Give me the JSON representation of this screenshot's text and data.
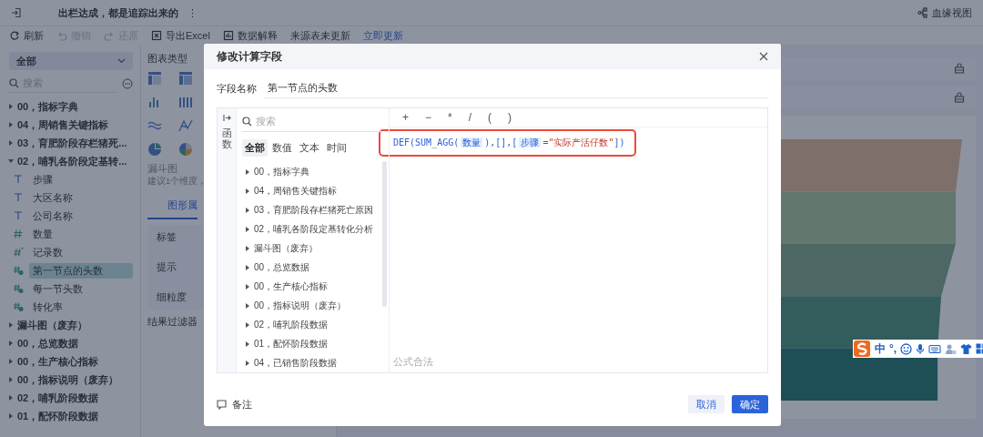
{
  "header": {
    "title": "出栏达成，都是追踪出来的",
    "more": "⋮",
    "lineage": "血缘视图"
  },
  "toolbar": [
    {
      "label": "刷新",
      "disabled": false
    },
    {
      "label": "撤销",
      "disabled": true
    },
    {
      "label": "还原",
      "disabled": true
    },
    {
      "label": "导出Excel",
      "disabled": false
    },
    {
      "label": "数据解释",
      "disabled": false
    }
  ],
  "update_notice": {
    "text": "来源表未更新",
    "link": "立即更新"
  },
  "sidebar": {
    "dropdown": "全部",
    "search_placeholder": "搜索",
    "tree": [
      {
        "label": "00，指标字典",
        "expanded": false,
        "selected": false
      },
      {
        "label": "04，周销售关键指标",
        "expanded": false,
        "selected": false
      },
      {
        "label": "03，育肥阶段存栏猪死...",
        "expanded": false,
        "selected": false
      },
      {
        "label": "02，哺乳各阶段定基转...",
        "expanded": true,
        "selected": false,
        "children": [
          {
            "label": "步骤",
            "kind": "text",
            "selected": false
          },
          {
            "label": "大区名称",
            "kind": "text",
            "selected": false
          },
          {
            "label": "公司名称",
            "kind": "text",
            "selected": false
          },
          {
            "label": "数量",
            "kind": "number",
            "selected": false
          },
          {
            "label": "记录数",
            "kind": "record",
            "selected": false
          },
          {
            "label": "第一节点的头数",
            "kind": "calc",
            "selected": true
          },
          {
            "label": "每一节头数",
            "kind": "calc",
            "selected": false
          },
          {
            "label": "转化率",
            "kind": "calc",
            "selected": false
          }
        ]
      },
      {
        "label": "漏斗图（废弃）",
        "expanded": false,
        "selected": false
      },
      {
        "label": "00，总览数据",
        "expanded": false,
        "selected": false
      },
      {
        "label": "00，生产核心指标",
        "expanded": false,
        "selected": false
      },
      {
        "label": "00，指标说明（废弃）",
        "expanded": false,
        "selected": false
      },
      {
        "label": "02，哺乳阶段数据",
        "expanded": false,
        "selected": false
      },
      {
        "label": "01，配怀阶段数据",
        "expanded": false,
        "selected": false
      }
    ]
  },
  "chart_panel": {
    "title": "图表类型",
    "chart_name": "漏斗图",
    "hint": "建议1个维度，",
    "tab": "图形属",
    "properties": [
      "标签",
      "提示",
      "细粒度"
    ],
    "filter_title": "结果过滤器"
  },
  "ime": {
    "mode": "中",
    "punct": "°,"
  },
  "dialog": {
    "title": "修改计算字段",
    "field_label": "字段名称",
    "field_value": "第一节点的头数",
    "side_tab": "函数",
    "search_placeholder": "搜索",
    "categories": [
      {
        "label": "全部",
        "selected": true
      },
      {
        "label": "数值",
        "selected": false
      },
      {
        "label": "文本",
        "selected": false
      },
      {
        "label": "时间",
        "selected": false
      }
    ],
    "function_groups": [
      "00，指标字典",
      "04，周销售关键指标",
      "03，育肥阶段存栏猪死亡原因",
      "02，哺乳各阶段定基转化分析",
      "漏斗图（废弃）",
      "00，总览数据",
      "00，生产核心指标",
      "00，指标说明（废弃）",
      "02，哺乳阶段数据",
      "01，配怀阶段数据",
      "04，已销售阶段数据"
    ],
    "operators": [
      "+",
      "−",
      "*",
      "/",
      "(",
      ")"
    ],
    "formula": {
      "highlighted": true,
      "tokens": [
        {
          "kind": "code",
          "text": "DEF(SUM_AGG("
        },
        {
          "kind": "field",
          "text": "数量"
        },
        {
          "kind": "code",
          "text": "),[],["
        },
        {
          "kind": "field",
          "text": "步骤"
        },
        {
          "kind": "code",
          "text": "="
        },
        {
          "kind": "string",
          "text": "\"实际产活仔数\""
        },
        {
          "kind": "code",
          "text": "])"
        }
      ]
    },
    "status": "公式合法",
    "note": "备注",
    "buttons": [
      {
        "label": "取消",
        "kind": "secondary"
      },
      {
        "label": "确定",
        "kind": "primary"
      }
    ]
  }
}
